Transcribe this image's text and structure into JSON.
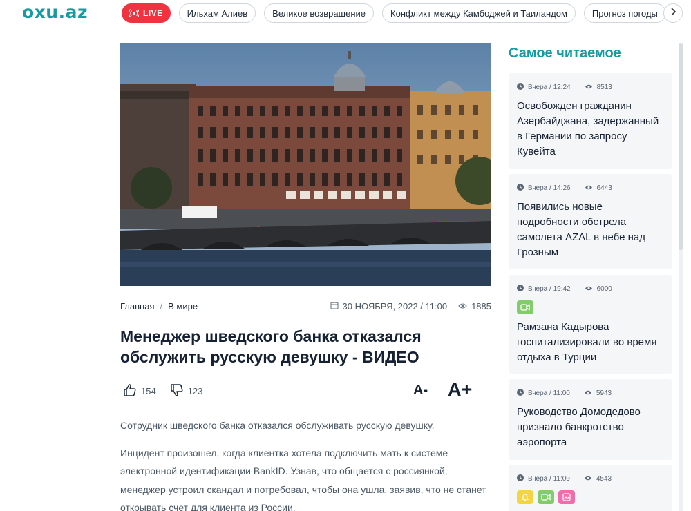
{
  "site": {
    "logo": "oxu.az"
  },
  "nav": {
    "live_label": "LIVE",
    "tags": [
      "Ильхам Алиев",
      "Великое возвращение",
      "Конфликт между Камбоджей и Таиландом",
      "Прогноз погоды"
    ]
  },
  "article": {
    "breadcrumb": {
      "home": "Главная",
      "separator": "/",
      "section": "В мире"
    },
    "date": "30 НОЯБРЯ, 2022 / 11:00",
    "views": "1885",
    "title": "Менеджер шведского банка отказался обслужить русскую девушку - ВИДЕО",
    "likes": "154",
    "dislikes": "123",
    "font_decrease": "A-",
    "font_increase": "A+",
    "paragraphs": [
      "Сотрудник шведского банка отказался обслуживать русскую девушку.",
      "Инцидент произошел, когда клиентка хотела подключить мать к системе электронной идентификации BankID. Узнав, что общается с россиянкой, менеджер устроил скандал и потребовал, чтобы она ушла, заявив, что не станет открывать счет для клиента из России."
    ]
  },
  "sidebar": {
    "title": "Самое читаемое",
    "items": [
      {
        "time": "Вчера / 12:24",
        "views": "8513",
        "title": "Освобожден гражданин Азербайджана, задержанный в Германии по запросу Кувейта",
        "badges": []
      },
      {
        "time": "Вчера / 14:26",
        "views": "6443",
        "title": "Появились новые подробности обстрела самолета AZAL в небе над Грозным",
        "badges": []
      },
      {
        "time": "Вчера / 19:42",
        "views": "6000",
        "title": "Рамзана Кадырова госпитализировали во время отдыха в Турции",
        "badges": [
          "video"
        ]
      },
      {
        "time": "Вчера / 11:00",
        "views": "5943",
        "title": "Руководство Домодедово признало банкротство аэропорта",
        "badges": []
      },
      {
        "time": "Вчера / 11:09",
        "views": "4543",
        "title": "",
        "badges": [
          "alert",
          "video",
          "photo"
        ]
      }
    ]
  },
  "colors": {
    "brand": "#169ba2",
    "live": "#ef3341",
    "text": "#162233",
    "card_bg": "#f4f6f7"
  }
}
